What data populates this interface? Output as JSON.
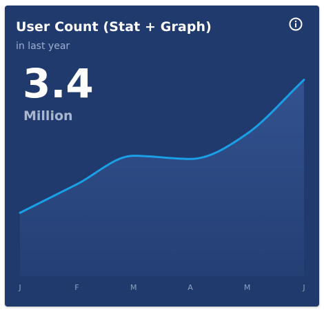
{
  "card": {
    "title": "User Count (Stat + Graph)",
    "subtitle": "in last year",
    "info_icon": "info-circle-icon"
  },
  "stat": {
    "value": "3.4",
    "unit": "Million"
  },
  "colors": {
    "card_background": "#213a6e",
    "line": "#1aa0e6",
    "area_fill_top": "#33528f",
    "area_fill_bottom": "#243f74",
    "tick_label": "#8fa0c2"
  },
  "chart_data": {
    "type": "area",
    "categories": [
      "J",
      "F",
      "M",
      "A",
      "M",
      "J"
    ],
    "values": [
      1.0,
      1.45,
      1.9,
      1.85,
      2.25,
      3.1
    ],
    "ylim": [
      0,
      3.4
    ],
    "grid": false
  }
}
